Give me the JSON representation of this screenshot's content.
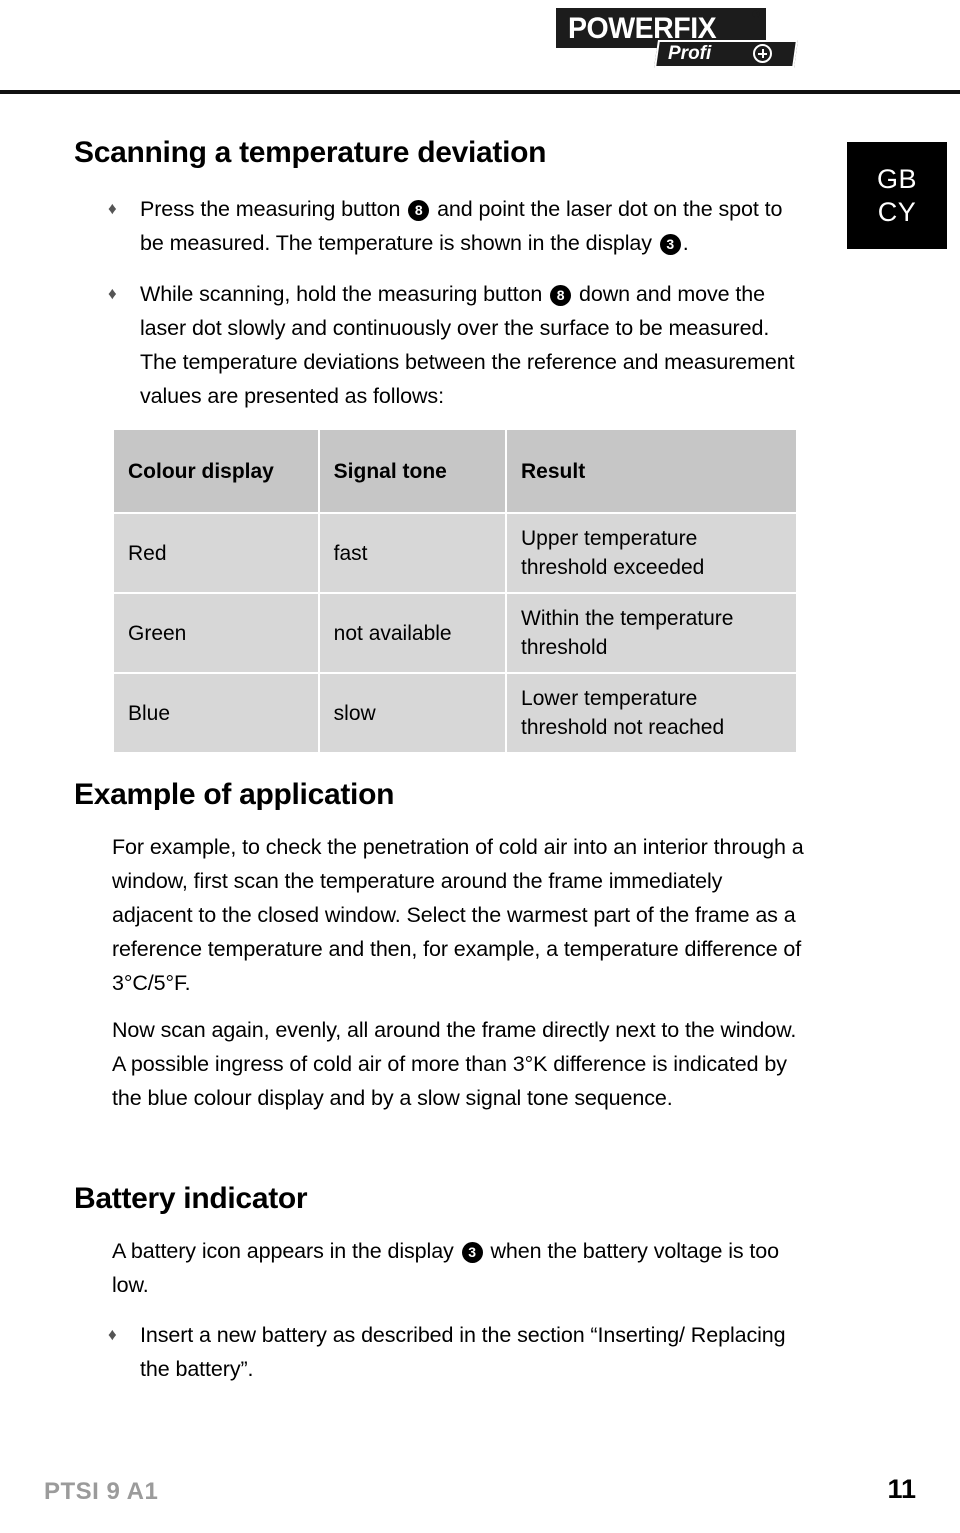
{
  "brand": {
    "name": "POWERFIX",
    "registered": "®",
    "sub": "Profi",
    "plus_icon": "plus-circle-icon"
  },
  "country_box": {
    "lines": [
      "GB",
      "CY"
    ]
  },
  "sections": {
    "scanning": {
      "title": "Scanning a temperature deviation",
      "bullets": [
        {
          "marker": "♦",
          "parts": [
            {
              "type": "text",
              "value": "Press the measuring button "
            },
            {
              "type": "badge",
              "value": "8"
            },
            {
              "type": "text",
              "value": " and point the laser dot on the spot to be measured. The temperature is shown in the display "
            },
            {
              "type": "badge",
              "value": "3"
            },
            {
              "type": "text",
              "value": "."
            }
          ]
        },
        {
          "marker": "♦",
          "parts": [
            {
              "type": "text",
              "value": "While scanning, hold the measuring button "
            },
            {
              "type": "badge",
              "value": "8"
            },
            {
              "type": "text",
              "value": " down and move the laser dot slowly and continuously over the surface to be measured. The temperature deviations between the reference and measurement values are presented as follows:"
            }
          ]
        }
      ]
    },
    "example": {
      "title": "Example of application",
      "paragraphs": [
        "For example, to check the penetration of cold air into an interior through a window, first scan the temperature around the frame immediately adjacent to the closed window. Select the warmest part of the frame as a reference temperature and then, for example, a temperature difference of 3°C/5°F.",
        "Now scan again, evenly, all around the frame directly next to the window. A possible ingress of cold air of more than 3°K difference is indicated by the blue colour display and by a slow signal tone sequence."
      ]
    },
    "battery": {
      "title": "Battery indicator",
      "paragraph_parts": [
        {
          "type": "text",
          "value": "A battery icon appears in the display "
        },
        {
          "type": "badge",
          "value": "3"
        },
        {
          "type": "text",
          "value": " when the battery voltage is too low."
        }
      ],
      "bullets": [
        {
          "marker": "♦",
          "parts": [
            {
              "type": "text",
              "value": "Insert a new battery as described in the section “Inserting/ Replacing the battery”."
            }
          ]
        }
      ]
    }
  },
  "table": {
    "headers": [
      "Colour display",
      "Signal tone",
      "Result"
    ],
    "rows": [
      [
        "Red",
        "fast",
        "Upper temperature threshold exceeded"
      ],
      [
        "Green",
        "not available",
        "Within the temperature threshold"
      ],
      [
        "Blue",
        "slow",
        "Lower temperature threshold not reached"
      ]
    ]
  },
  "footer": {
    "model": "PTSI 9 A1",
    "page": "11"
  },
  "colors": {
    "header_row_bg": "#c6c6c6",
    "body_row_bg": "#d7d7d7",
    "rule": "#111111",
    "country_bg": "#000000",
    "footer_model": "#9b9b9b"
  }
}
